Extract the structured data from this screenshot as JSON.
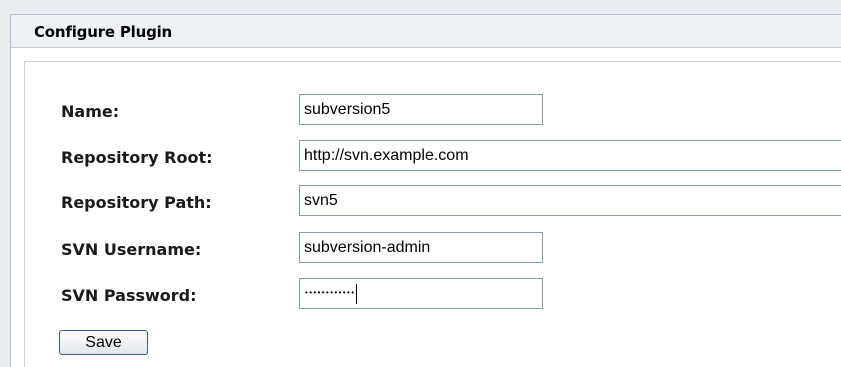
{
  "panel": {
    "title": "Configure Plugin"
  },
  "form": {
    "fields": [
      {
        "label": "Name:",
        "value": "subversion5"
      },
      {
        "label": "Repository Root:",
        "value": "http://svn.example.com"
      },
      {
        "label": "Repository Path:",
        "value": "svn5"
      },
      {
        "label": "SVN Username:",
        "value": "subversion-admin"
      },
      {
        "label": "SVN Password:",
        "value": "••••••••••••"
      }
    ],
    "save_label": "Save"
  }
}
